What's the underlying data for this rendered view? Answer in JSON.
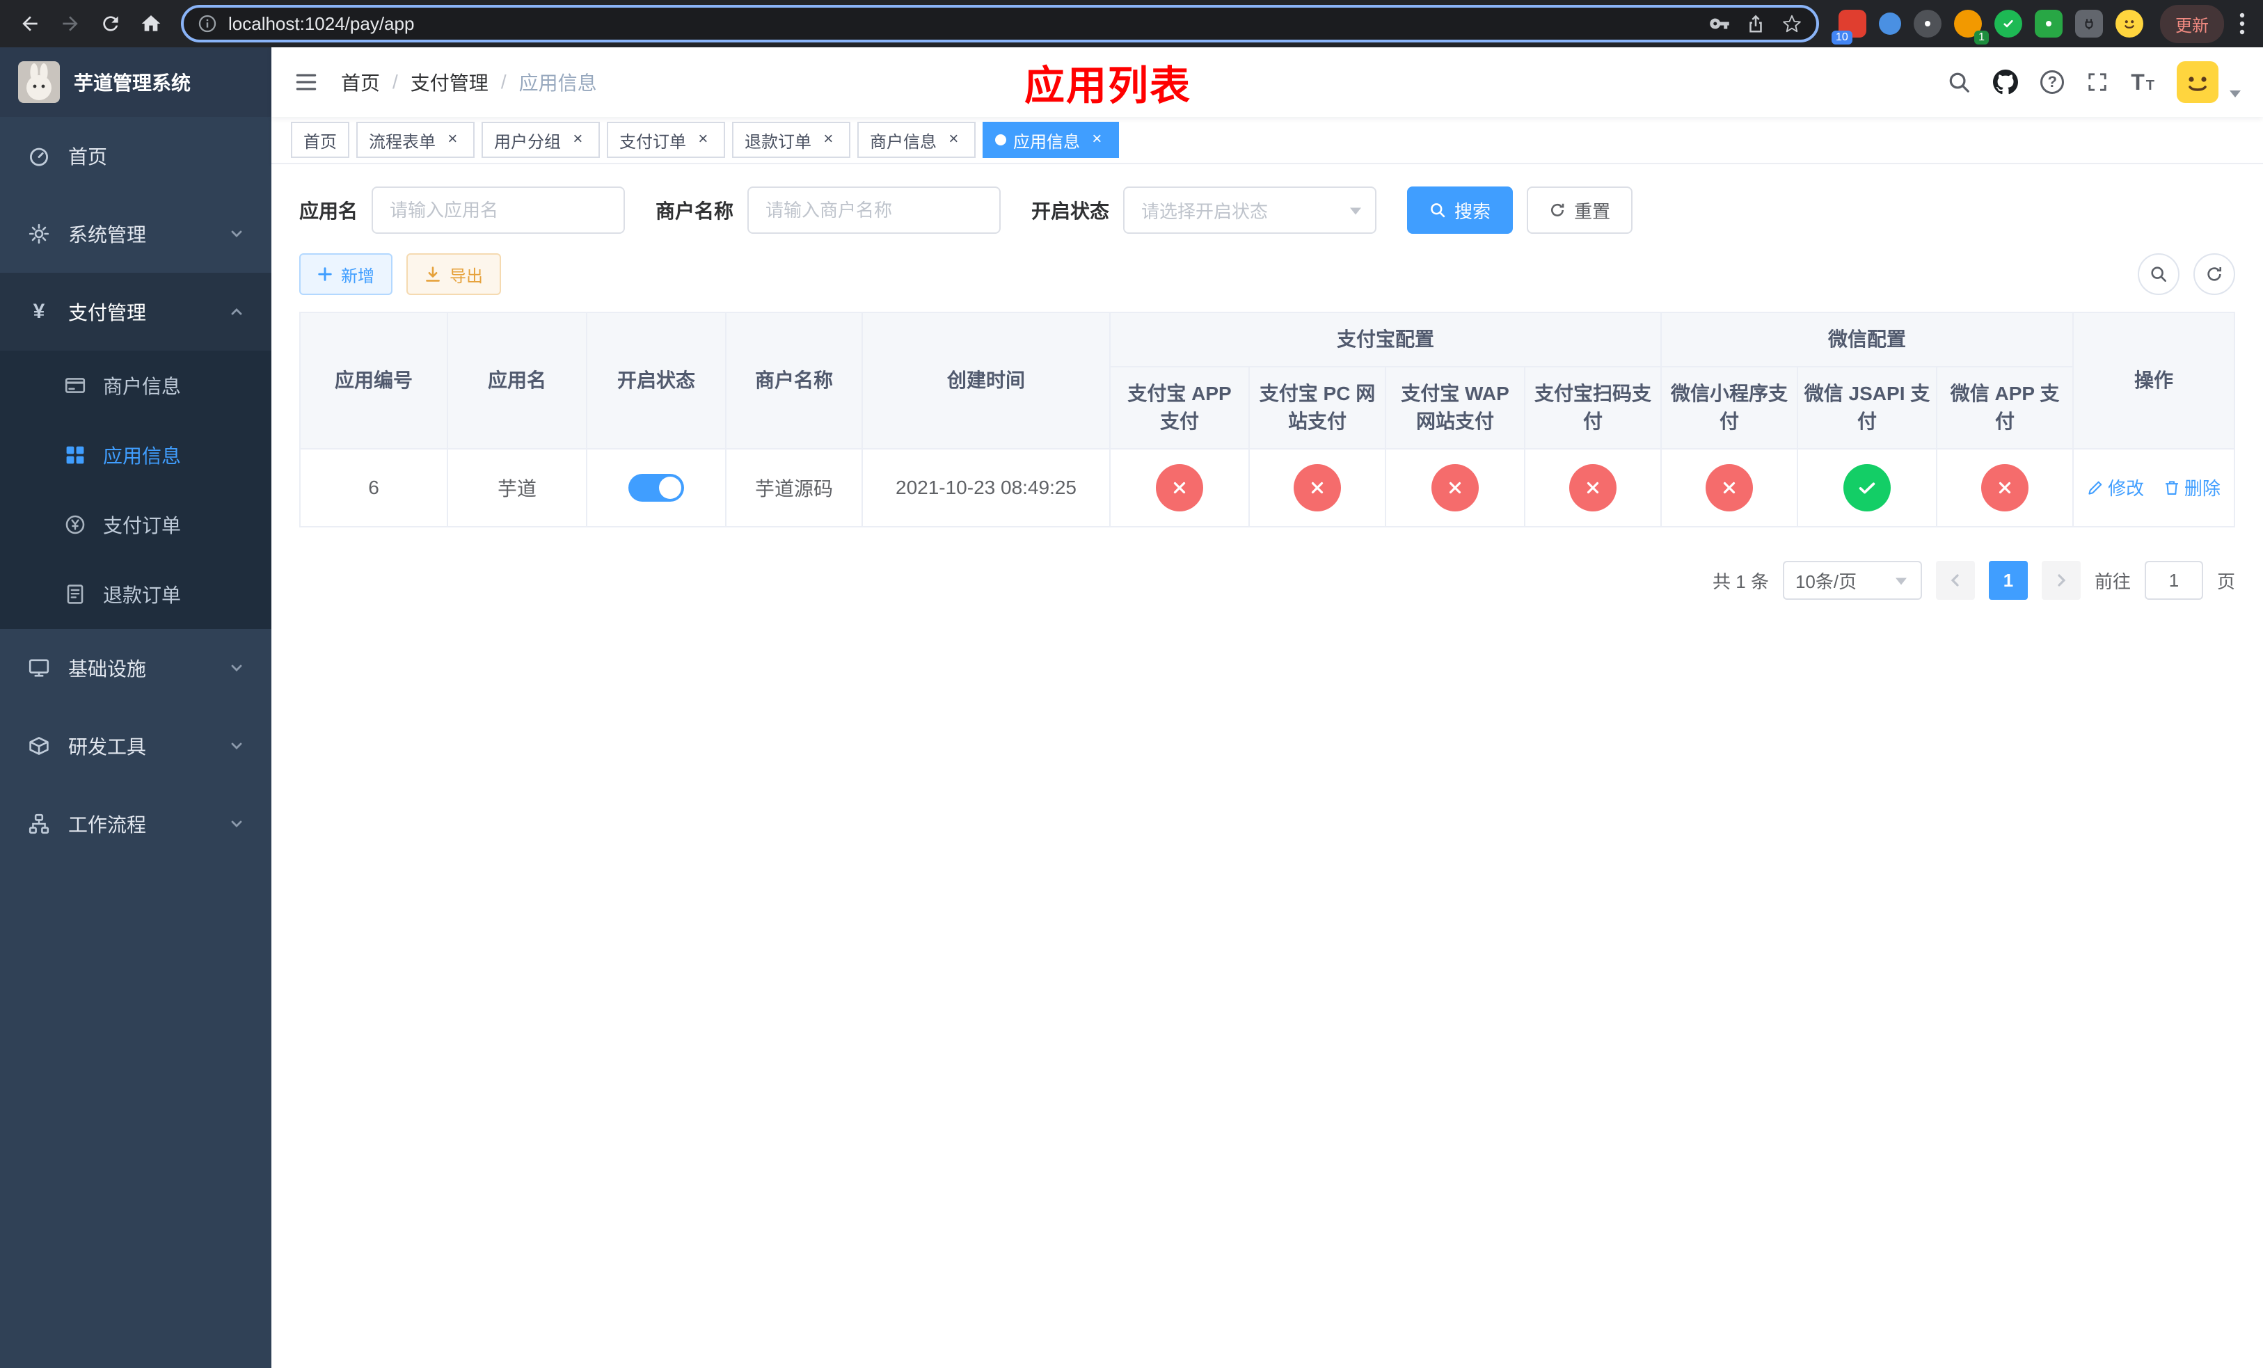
{
  "browser": {
    "url": "localhost:1024/pay/app",
    "update_label": "更新",
    "ext_badge_red": "10",
    "ext_badge_avatar": "1"
  },
  "sidebar": {
    "title": "芋道管理系统",
    "items": [
      {
        "label": "首页"
      },
      {
        "label": "系统管理"
      },
      {
        "label": "支付管理"
      }
    ],
    "sub_items": [
      {
        "label": "商户信息"
      },
      {
        "label": "应用信息"
      },
      {
        "label": "支付订单"
      },
      {
        "label": "退款订单"
      }
    ],
    "items_bottom": [
      {
        "label": "基础设施"
      },
      {
        "label": "研发工具"
      },
      {
        "label": "工作流程"
      }
    ]
  },
  "header": {
    "breadcrumb": [
      "首页",
      "支付管理",
      "应用信息"
    ],
    "separator": "/",
    "page_title": "应用列表"
  },
  "tags": [
    {
      "label": "首页",
      "active": false,
      "closable": false
    },
    {
      "label": "流程表单",
      "active": false,
      "closable": true
    },
    {
      "label": "用户分组",
      "active": false,
      "closable": true
    },
    {
      "label": "支付订单",
      "active": false,
      "closable": true
    },
    {
      "label": "退款订单",
      "active": false,
      "closable": true
    },
    {
      "label": "商户信息",
      "active": false,
      "closable": true
    },
    {
      "label": "应用信息",
      "active": true,
      "closable": true
    }
  ],
  "filters": {
    "app_name_label": "应用名",
    "app_name_placeholder": "请输入应用名",
    "merchant_label": "商户名称",
    "merchant_placeholder": "请输入商户名称",
    "status_label": "开启状态",
    "status_placeholder": "请选择开启状态",
    "search_label": "搜索",
    "reset_label": "重置"
  },
  "toolbar": {
    "add_label": "新增",
    "export_label": "导出"
  },
  "table": {
    "groups": {
      "alipay": "支付宝配置",
      "wechat": "微信配置"
    },
    "columns": [
      "应用编号",
      "应用名",
      "开启状态",
      "商户名称",
      "创建时间",
      "操作"
    ],
    "sub_columns": [
      "支付宝 APP 支付",
      "支付宝 PC 网站支付",
      "支付宝 WAP 网站支付",
      "支付宝扫码支付",
      "微信小程序支付",
      "微信 JSAPI 支付",
      "微信 APP 支付"
    ],
    "actions": {
      "edit": "修改",
      "delete": "删除"
    },
    "rows": [
      {
        "id": "6",
        "name": "芋道",
        "enabled": true,
        "merchant": "芋道源码",
        "created": "2021-10-23 08:49:25",
        "configs": [
          "no",
          "no",
          "no",
          "no",
          "no",
          "yes",
          "no"
        ]
      }
    ]
  },
  "pagination": {
    "total": "共 1 条",
    "page_size": "10条/页",
    "page": "1",
    "goto_label": "前往",
    "goto_value": "1",
    "page_unit": "页"
  },
  "colors": {
    "accent": "#409eff",
    "success": "#13ce66",
    "danger": "#f56c6c",
    "warning": "#e6a23c",
    "title": "#ff0000",
    "sidebar_bg": "#304156",
    "submenu_bg": "#1f2d3d"
  }
}
